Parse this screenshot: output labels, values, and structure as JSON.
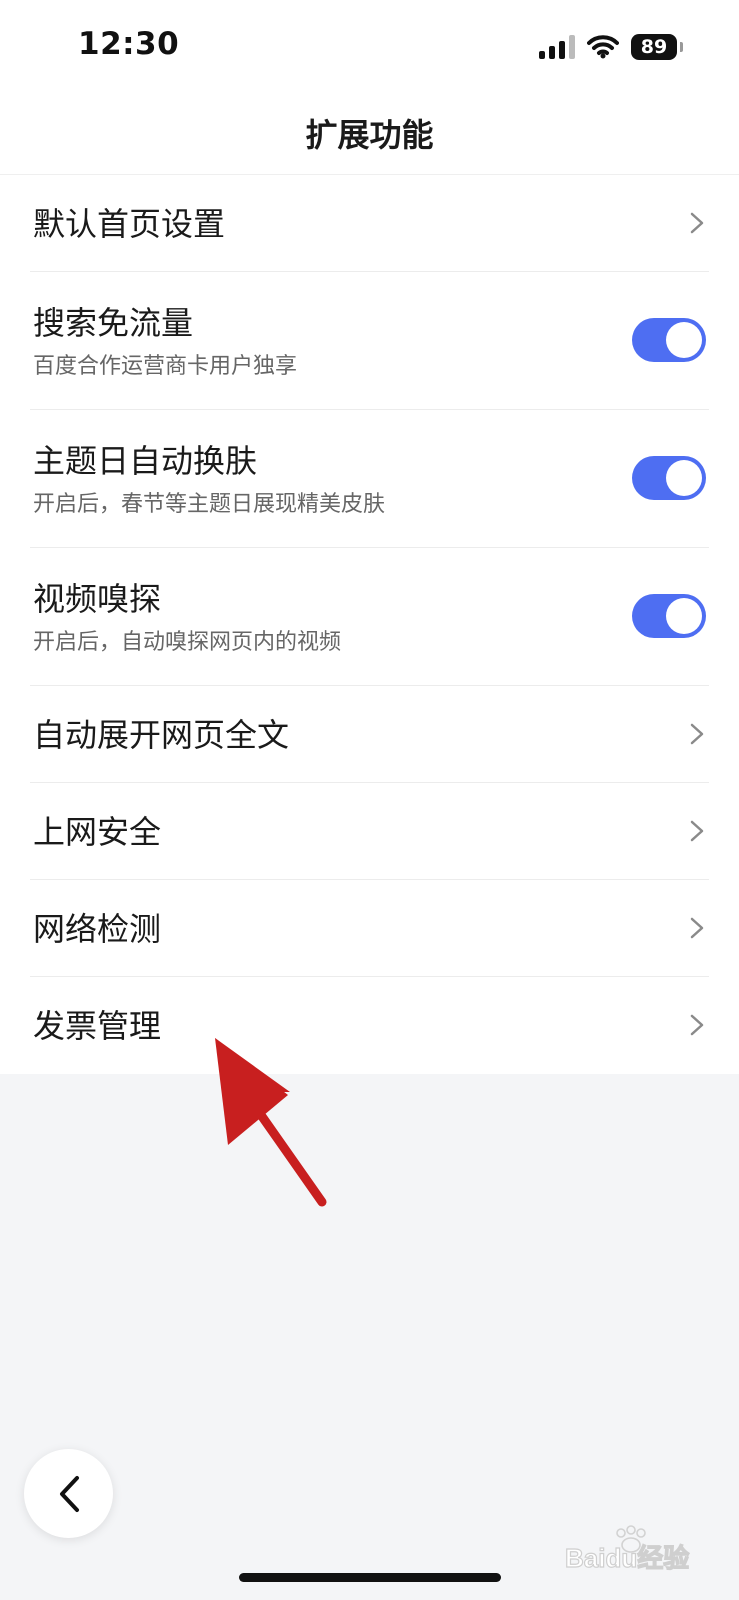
{
  "status_bar": {
    "time": "12:30",
    "battery": "89",
    "icons": [
      "signal-icon",
      "wifi-icon",
      "battery-icon"
    ]
  },
  "header": {
    "title": "扩展功能"
  },
  "settings": {
    "items": [
      {
        "title": "默认首页设置",
        "control": "chevron"
      },
      {
        "title": "搜索免流量",
        "subtitle": "百度合作运营商卡用户独享",
        "control": "toggle",
        "on": true
      },
      {
        "title": "主题日自动换肤",
        "subtitle": "开启后，春节等主题日展现精美皮肤",
        "control": "toggle",
        "on": true
      },
      {
        "title": "视频嗅探",
        "subtitle": "开启后，自动嗅探网页内的视频",
        "control": "toggle",
        "on": true
      },
      {
        "title": "自动展开网页全文",
        "control": "chevron"
      },
      {
        "title": "上网安全",
        "control": "chevron"
      },
      {
        "title": "网络检测",
        "control": "chevron"
      },
      {
        "title": "发票管理",
        "control": "chevron"
      }
    ]
  },
  "colors": {
    "toggle_on": "#4e6ef2",
    "annotation_arrow": "#c81f1f",
    "background": "#f4f5f7"
  },
  "watermark": {
    "text": "Baidu经验"
  }
}
